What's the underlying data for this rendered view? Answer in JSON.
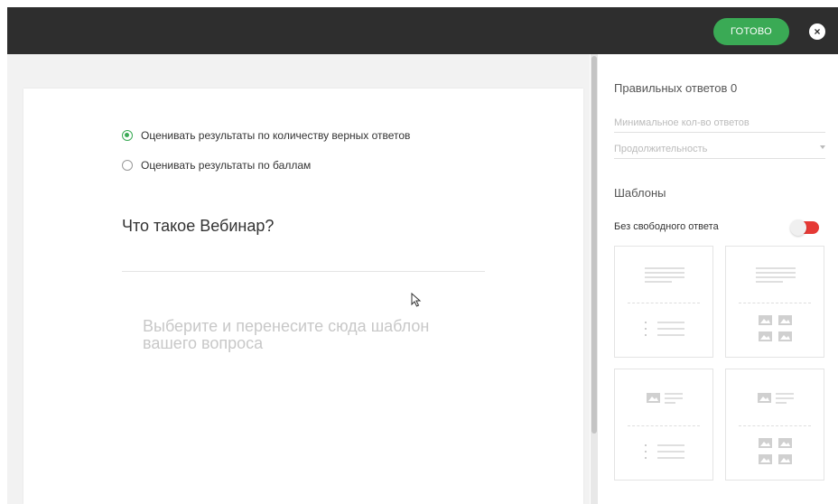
{
  "toolbar": {
    "done_label": "ГОТОВО",
    "close_glyph": "×",
    "accent_color": "#3aaa55"
  },
  "editor": {
    "scoring_options": [
      {
        "label": "Оценивать результаты по количеству верных ответов",
        "selected": true
      },
      {
        "label": "Оценивать результаты по баллам",
        "selected": false
      }
    ],
    "question_text": "Что такое Вебинар?",
    "drop_placeholder": "Выберите и перенесите сюда шаблон вашего вопроса"
  },
  "settings": {
    "correct_answers_label": "Правильных ответов 0",
    "min_answers_placeholder": "Минимальное кол-во ответов",
    "duration_placeholder": "Продолжительность",
    "templates_heading": "Шаблоны",
    "free_answer_label": "Без свободного ответа",
    "free_answer_toggle_color": "#e53935",
    "templates": [
      {
        "name": "text-question-text-answers",
        "top_icon": "text-lines-icon",
        "bottom_icon": "bullet-list-icon"
      },
      {
        "name": "text-question-image-answers",
        "top_icon": "text-lines-icon",
        "bottom_icon": "image-grid-icon"
      },
      {
        "name": "image-question-text-answers",
        "top_icon": "image-text-icon",
        "bottom_icon": "bullet-list-icon"
      },
      {
        "name": "image-question-image-answers",
        "top_icon": "image-text-icon",
        "bottom_icon": "image-grid-icon"
      }
    ]
  }
}
